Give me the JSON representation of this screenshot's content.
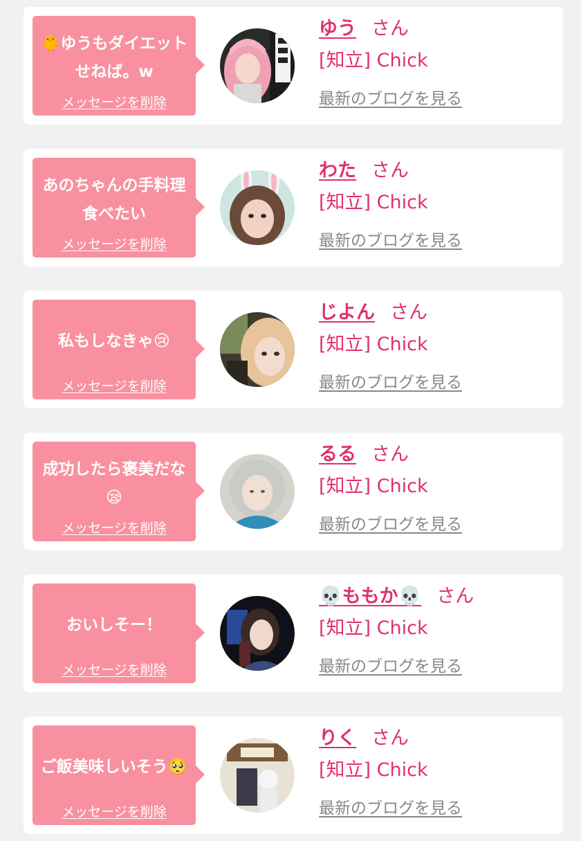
{
  "theme": {
    "bubble_color": "#f9909f",
    "name_color": "#e0306c",
    "link_color": "#888888",
    "background": "#f1f1f1"
  },
  "cards": [
    {
      "message": "🐥ゆうもダイエットせねば。w",
      "delete_label": "メッセージを削除",
      "name": "ゆう",
      "honorific": "さん",
      "status": "[知立] Chick",
      "blog_label": "最新のブログを見る"
    },
    {
      "message": "あのちゃんの手料理食べたい",
      "delete_label": "メッセージを削除",
      "name": "わた",
      "honorific": "さん",
      "status": "[知立] Chick",
      "blog_label": "最新のブログを見る"
    },
    {
      "message": "私もしなきゃ😢",
      "delete_label": "メッセージを削除",
      "name": "じよん",
      "honorific": "さん",
      "status": "[知立] Chick",
      "blog_label": "最新のブログを見る"
    },
    {
      "message": "成功したら褒美だな😪",
      "delete_label": "メッセージを削除",
      "name": "るる",
      "honorific": "さん",
      "status": "[知立] Chick",
      "blog_label": "最新のブログを見る"
    },
    {
      "message": "おいしそー！",
      "delete_label": "メッセージを削除",
      "name": "💀ももか💀",
      "honorific": "さん",
      "status": "[知立] Chick",
      "blog_label": "最新のブログを見る"
    },
    {
      "message": "ご飯美味しいそう🥺",
      "delete_label": "メッセージを削除",
      "name": "りく",
      "honorific": "さん",
      "status": "[知立] Chick",
      "blog_label": "最新のブログを見る"
    }
  ]
}
